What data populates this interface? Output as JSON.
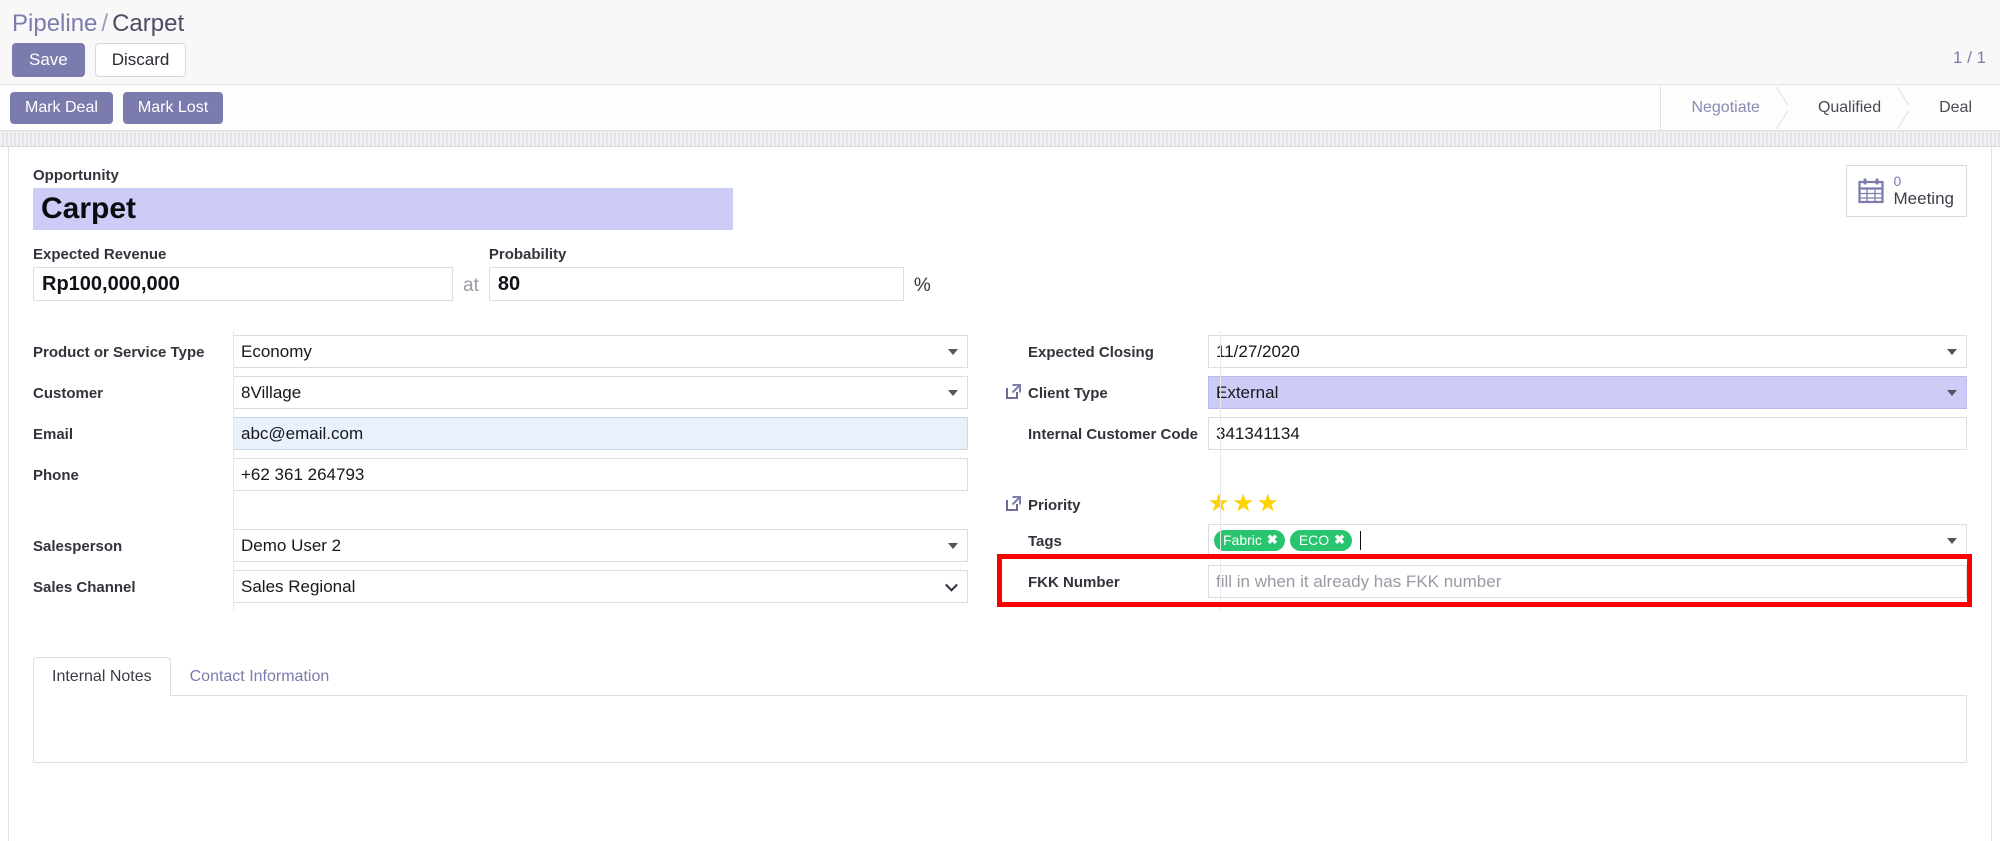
{
  "breadcrumb": {
    "root": "Pipeline",
    "separator": "/",
    "current": "Carpet"
  },
  "toolbar": {
    "save_label": "Save",
    "discard_label": "Discard",
    "pager": "1 / 1"
  },
  "statusbar": {
    "mark_deal_label": "Mark Deal",
    "mark_lost_label": "Mark Lost",
    "stages": [
      {
        "label": "Negotiate",
        "active": false
      },
      {
        "label": "Qualified",
        "active": true
      },
      {
        "label": "Deal",
        "active": true
      }
    ]
  },
  "stat_button": {
    "icon": "calendar-icon",
    "count": "0",
    "label": "Meeting"
  },
  "form": {
    "title_label": "Opportunity",
    "title_value": "Carpet",
    "expected_revenue_label": "Expected Revenue",
    "expected_revenue_value": "Rp100,000,000",
    "at_word": "at",
    "probability_label": "Probability",
    "probability_value": "80",
    "percent_symbol": "%",
    "left_fields": [
      {
        "label": "Product or Service Type",
        "value": "Economy",
        "widget": "select",
        "style": "plain"
      },
      {
        "label": "Customer",
        "value": "8Village",
        "widget": "select",
        "style": "plain"
      },
      {
        "label": "Email",
        "value": "abc@email.com",
        "widget": "text",
        "style": "blue"
      },
      {
        "label": "Phone",
        "value": "+62 361 264793",
        "widget": "text",
        "style": "plain"
      },
      {
        "label": "Salesperson",
        "value": "Demo User 2",
        "widget": "select",
        "style": "plain"
      },
      {
        "label": "Sales Channel",
        "value": "Sales Regional",
        "widget": "select-thin",
        "style": "plain"
      }
    ],
    "right_fields": [
      {
        "label": "Expected Closing",
        "value": "11/27/2020",
        "widget": "select",
        "style": "plain",
        "ext_icon": false
      },
      {
        "label": "Client Type",
        "value": "External",
        "widget": "select",
        "style": "purple",
        "ext_icon": true
      },
      {
        "label": "Internal Customer Code",
        "value": "341341134",
        "widget": "text",
        "style": "plain",
        "ext_icon": false
      }
    ],
    "priority_label": "Priority",
    "priority_stars": 3,
    "priority_star_glyph": "★",
    "tags_label": "Tags",
    "tags": [
      {
        "name": "Fabric",
        "remove_glyph": "✖"
      },
      {
        "name": "ECO",
        "remove_glyph": "✖"
      }
    ],
    "fkk_label": "FKK Number",
    "fkk_placeholder": "fill in when it already has FKK number",
    "fkk_value": ""
  },
  "notebook": {
    "tabs": [
      {
        "label": "Internal Notes",
        "active": true
      },
      {
        "label": "Contact Information",
        "active": false
      }
    ]
  },
  "colors": {
    "brand_purple": "#7c7bad",
    "highlight_purple": "#ccccf6",
    "tag_green": "#29c46f",
    "star_gold": "#ffd200",
    "annotation_red": "#fc0000",
    "field_blue": "#e8f1fc"
  }
}
